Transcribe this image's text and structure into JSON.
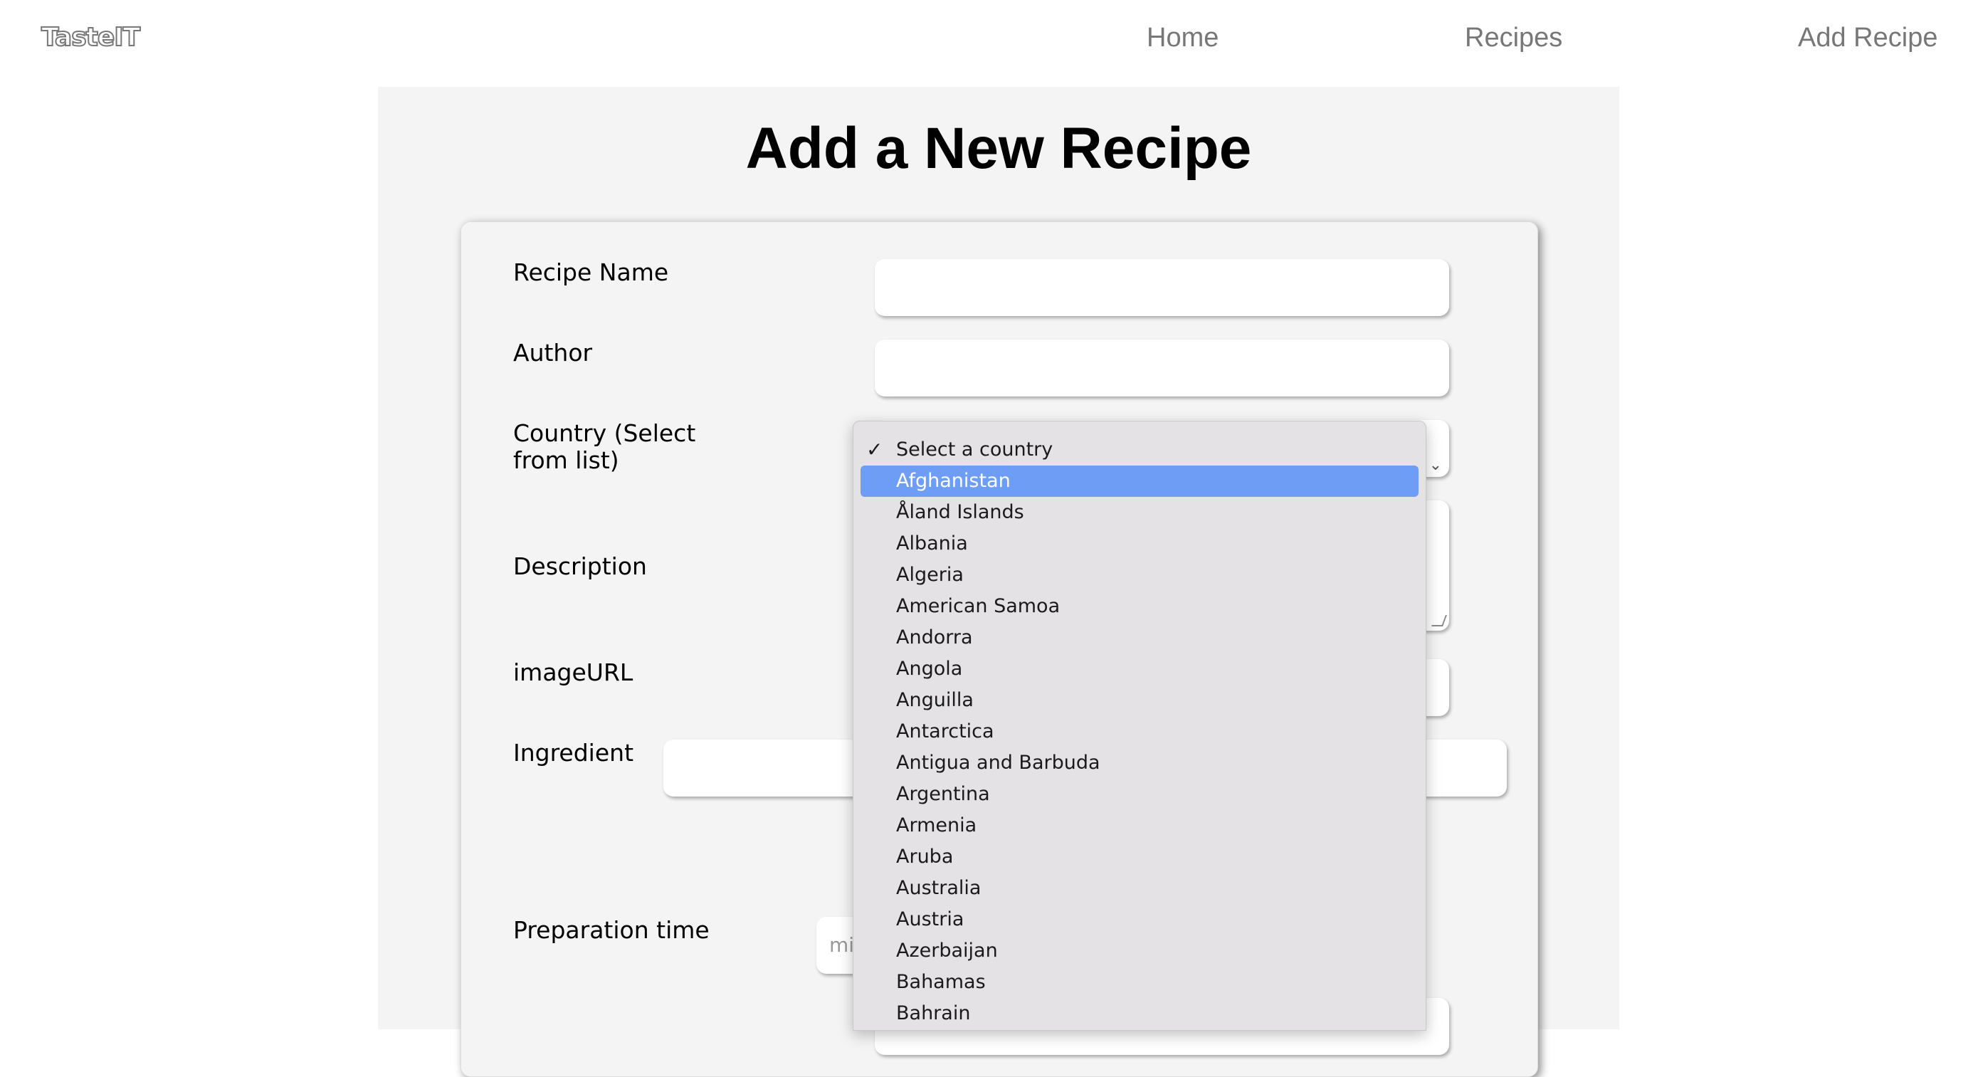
{
  "brand": {
    "logo": "TasteIT"
  },
  "nav": {
    "home": "Home",
    "recipes": "Recipes",
    "add_recipe": "Add Recipe"
  },
  "page": {
    "title": "Add a New Recipe"
  },
  "form": {
    "recipe_name_label": "Recipe Name",
    "author_label": "Author",
    "country_label": "Country (Select from list)",
    "description_label": "Description",
    "image_url_label": "imageURL",
    "ingredient_label": "Ingredient",
    "prep_time_label": "Preparation time",
    "prep_time_placeholder": "minu"
  },
  "country_dropdown": {
    "checked_option": "Select a country",
    "highlighted_option": "Afghanistan",
    "options": [
      "Åland Islands",
      "Albania",
      "Algeria",
      "American Samoa",
      "Andorra",
      "Angola",
      "Anguilla",
      "Antarctica",
      "Antigua and Barbuda",
      "Argentina",
      "Armenia",
      "Aruba",
      "Australia",
      "Austria",
      "Azerbaijan",
      "Bahamas",
      "Bahrain"
    ]
  }
}
